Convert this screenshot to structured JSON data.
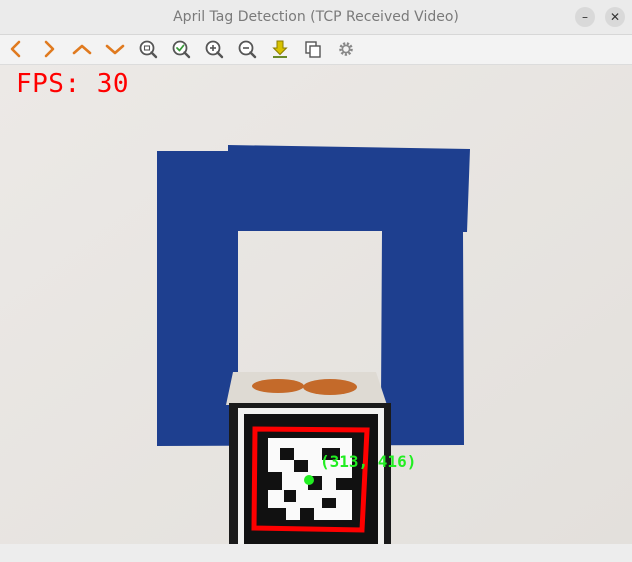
{
  "window": {
    "title": "April Tag Detection (TCP Received Video)",
    "minimize_glyph": "–",
    "close_glyph": "✕"
  },
  "toolbar": {
    "tools": [
      {
        "name": "pan-left-icon"
      },
      {
        "name": "pan-right-icon"
      },
      {
        "name": "pan-up-icon"
      },
      {
        "name": "pan-down-icon"
      },
      {
        "name": "zoom-original-icon"
      },
      {
        "name": "zoom-fit-icon"
      },
      {
        "name": "zoom-in-icon"
      },
      {
        "name": "zoom-out-icon"
      },
      {
        "name": "save-image-icon"
      },
      {
        "name": "copy-image-icon"
      },
      {
        "name": "properties-gear-icon"
      }
    ],
    "colors": {
      "arrow": "#e07a1f",
      "zoom": "#5a5a5a",
      "fit_check": "#3a9a3a",
      "save": "#c8b400"
    }
  },
  "video": {
    "fps_text": "FPS: 30",
    "center_text": "(313, 416)",
    "colors": {
      "fps": "#ff0000",
      "tag_outline": "#ff0000",
      "center": "#22ee22",
      "tape": "#1e3f8f"
    }
  }
}
